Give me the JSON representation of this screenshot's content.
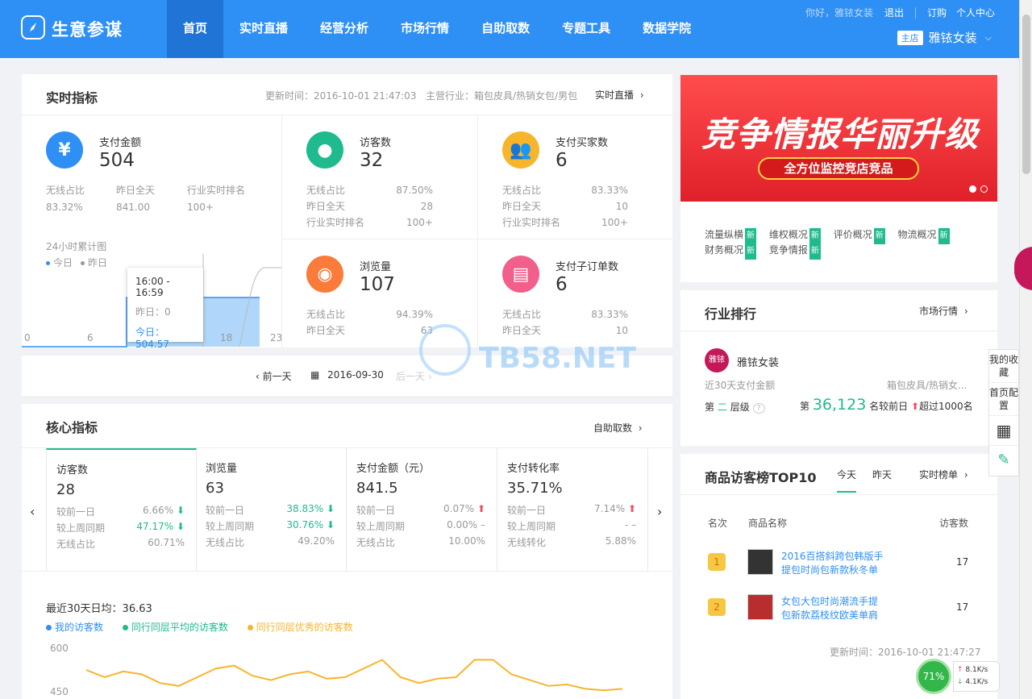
{
  "brand": "生意参谋",
  "nav": [
    "首页",
    "实时直播",
    "经营分析",
    "市场行情",
    "自助取数",
    "专题工具",
    "数据学院"
  ],
  "top": {
    "greet": "你好，雅铱女装",
    "logout": "退出",
    "order": "订购",
    "user": "个人中心",
    "shop_badge": "主店",
    "shop_name": "雅铱女装"
  },
  "realtime": {
    "title": "实时指标",
    "update": "更新时间：2016-10-01 21:47:03",
    "industry": "主营行业：箱包皮具/热销女包/男包",
    "link": "实时直播",
    "pay": {
      "label": "支付金额",
      "value": "504",
      "h1": "无线占比",
      "h2": "昨日全天",
      "h3": "行业实时排名",
      "v1": "83.32%",
      "v2": "841.00",
      "v3": "100+"
    },
    "chart_title": "24小时累计图",
    "legend_today": "今日",
    "legend_yday": "昨日",
    "ticks": [
      "0",
      "6",
      "12",
      "18",
      "23"
    ],
    "tooltip": {
      "time": "16:00 - 16:59",
      "yday": "昨日：0",
      "today": "今日：504.57"
    },
    "metrics": [
      {
        "label": "访客数",
        "value": "32",
        "rows": [
          [
            "无线占比",
            "87.50%"
          ],
          [
            "昨日全天",
            "28"
          ],
          [
            "行业实时排名",
            "100+"
          ]
        ],
        "color": "#1fba8e",
        "icon": "footprint-icon"
      },
      {
        "label": "支付买家数",
        "value": "6",
        "rows": [
          [
            "无线占比",
            "83.33%"
          ],
          [
            "昨日全天",
            "10"
          ],
          [
            "行业实时排名",
            "100+"
          ]
        ],
        "color": "#f7b52c",
        "icon": "users-icon"
      },
      {
        "label": "浏览量",
        "value": "107",
        "rows": [
          [
            "无线占比",
            "94.39%"
          ],
          [
            "昨日全天",
            "63"
          ]
        ],
        "color": "#fa7b3a",
        "icon": "eye-icon"
      },
      {
        "label": "支付子订单数",
        "value": "6",
        "rows": [
          [
            "无线占比",
            "83.33%"
          ],
          [
            "昨日全天",
            "10"
          ]
        ],
        "color": "#f25f8c",
        "icon": "clipboard-icon"
      }
    ]
  },
  "datebar": {
    "prev": "前一天",
    "date": "2016-09-30",
    "next": "后一天"
  },
  "core": {
    "title": "核心指标",
    "link": "自助取数",
    "cells": [
      {
        "name": "访客数",
        "value": "28",
        "r1": "较前一日",
        "v1": "6.66%",
        "a1": "down",
        "r2": "较上周同期",
        "v2": "47.17%",
        "a2": "down",
        "r3": "无线占比",
        "v3": "60.71%"
      },
      {
        "name": "浏览量",
        "value": "63",
        "r1": "较前一日",
        "v1": "38.83%",
        "a1": "down",
        "r2": "较上周同期",
        "v2": "30.76%",
        "a2": "down",
        "r3": "无线占比",
        "v3": "49.20%"
      },
      {
        "name": "支付金额（元）",
        "value": "841.5",
        "r1": "较前一日",
        "v1": "0.07%",
        "a1": "up",
        "r2": "较上周同期",
        "v2": "0.00% –",
        "a2": "",
        "r3": "无线占比",
        "v3": "10.00%"
      },
      {
        "name": "支付转化率",
        "value": "35.71%",
        "r1": "较前一日",
        "v1": "7.14%",
        "a1": "up",
        "r2": "较上周同期",
        "v2": "- –",
        "a2": "",
        "r3": "无线转化",
        "v3": "5.88%"
      }
    ],
    "avg": "最近30天日均：36.63",
    "legend": [
      "我的访客数",
      "同行同层平均的访客数",
      "同行同层优秀的访客数"
    ],
    "yticks": [
      "600",
      "450"
    ]
  },
  "banner": {
    "headline": "竞争情报华丽升级",
    "subline": "全方位监控竞店竞品"
  },
  "features": {
    "row1": [
      "流量纵横",
      "维权概况",
      "评价概况",
      "物流概况"
    ],
    "row2": [
      "财务概况",
      "竞争情报"
    ],
    "tag": "新"
  },
  "industry_rank": {
    "title": "行业排行",
    "link": "市场行情",
    "logo": "雅铱",
    "shop": "雅铱女装",
    "label": "近30天支付金额",
    "cat": "箱包皮具/热销女...",
    "tier_pre": "第",
    "tier": "二",
    "tier_post": "层级",
    "rank_pre": "第",
    "rank": "36,123",
    "rank_post": "名较前日",
    "change": "超过1000名"
  },
  "top10": {
    "title": "商品访客榜TOP10",
    "tab1": "今天",
    "tab2": "昨天",
    "link": "实时榜单",
    "h_rank": "名次",
    "h_name": "商品名称",
    "h_visits": "访客数",
    "items": [
      {
        "rank": "1",
        "name": "2016百搭斜跨包韩版手提包时尚包新款秋冬单",
        "visits": "17"
      },
      {
        "rank": "2",
        "name": "女包大包时尚潮流手提包新款荔枝纹欧美单肩",
        "visits": "17"
      }
    ],
    "update": "更新时间：2016-10-01 21:47:27"
  },
  "side": {
    "fav": "我的收藏",
    "cfg": "首页配置"
  },
  "net": {
    "pct": "71%",
    "up": "8.1K/s",
    "down": "4.1K/s"
  },
  "watermark": "TB58.NET",
  "chart_data": {
    "type": "line",
    "title": "最近30天日均：36.63",
    "series": [
      {
        "name": "同行同层优秀的访客数",
        "color": "#f7b52c",
        "values": [
          525,
          500,
          520,
          510,
          480,
          470,
          500,
          530,
          540,
          505,
          490,
          510,
          520,
          495,
          500,
          530,
          560,
          500,
          480,
          495,
          500,
          560,
          560,
          510,
          490,
          470,
          475,
          460,
          455,
          460
        ]
      }
    ],
    "ylim": [
      450,
      600
    ],
    "yticks": [
      600,
      450
    ]
  }
}
